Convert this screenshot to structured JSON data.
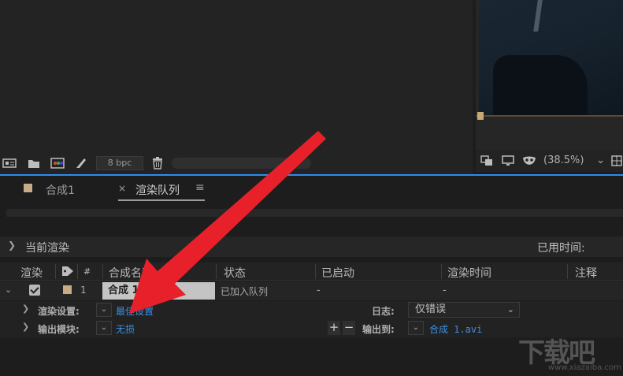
{
  "project_panel": {
    "bpc_label": "8 bpc"
  },
  "viewer": {
    "zoom_value": "(38.5%)"
  },
  "tabs": [
    {
      "label": "合成1"
    },
    {
      "label": "渲染队列"
    }
  ],
  "current_render": {
    "label": "当前渲染",
    "elapsed_label": "已用时间:"
  },
  "queue_header": {
    "render": "渲染",
    "number": "#",
    "comp_name": "合成名称",
    "status": "状态",
    "started": "已启动",
    "render_time": "渲染时间",
    "comment": "注释"
  },
  "queue_item": {
    "index": "1",
    "comp_name": "合成 1",
    "status": "已加入队列",
    "started": "-",
    "render_time": "-"
  },
  "render_settings": {
    "label": "渲染设置:",
    "value": "最佳设置",
    "log_label": "日志:",
    "log_value": "仅错误"
  },
  "output_module": {
    "label": "输出模块:",
    "value": "无损",
    "output_to_label": "输出到:",
    "output_file": "合成 1.avi"
  },
  "watermark": {
    "text": "下载吧",
    "url": "www.xiazaiba.com"
  },
  "colors": {
    "accent_blue": "#2d8ceb",
    "link_blue": "#3b8fe3",
    "arrow_red": "#e8202a",
    "label_swatch": "#c8ac86"
  }
}
